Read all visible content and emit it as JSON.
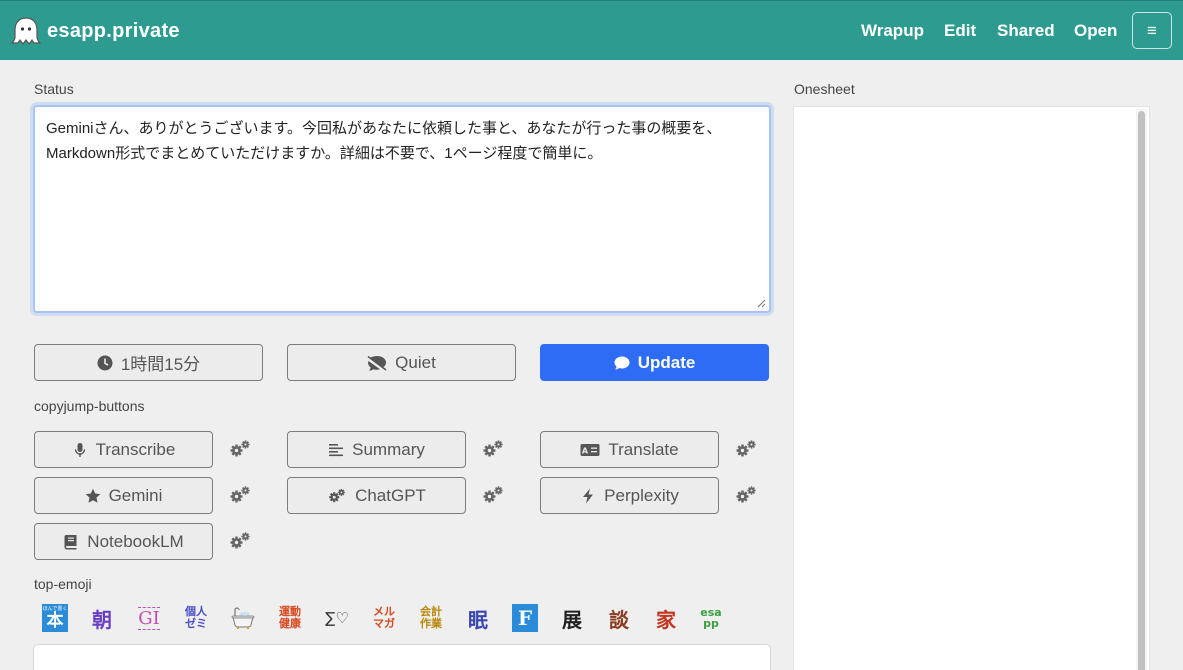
{
  "brand": {
    "name": "esapp.private"
  },
  "nav": {
    "wrapup": "Wrapup",
    "edit": "Edit",
    "shared": "Shared",
    "open": "Open",
    "menu": "≡"
  },
  "status": {
    "label": "Status",
    "text": "Geminiさん、ありがとうございます。今回私があなたに依頼した事と、あなたが行った事の概要を、Markdown形式でまとめていただけますか。詳細は不要で、1ページ程度で簡単に。"
  },
  "actions": {
    "time": "1時間15分",
    "quiet": "Quiet",
    "update": "Update"
  },
  "copyjump": {
    "label": "copyjump-buttons",
    "buttons": {
      "transcribe": "Transcribe",
      "summary": "Summary",
      "translate": "Translate",
      "gemini": "Gemini",
      "chatgpt": "ChatGPT",
      "perplexity": "Perplexity",
      "notebooklm": "NotebookLM"
    }
  },
  "top_emoji": {
    "label": "top-emoji",
    "items": [
      {
        "name": "hon-emoji",
        "text": "本",
        "sub": "ほんで書く",
        "bg": "#2a8bd8",
        "fg": "#ffffff"
      },
      {
        "name": "asa-emoji",
        "text": "朝",
        "fg": "#6b3fc4"
      },
      {
        "name": "gi-emoji",
        "text": "GI",
        "fg": "#c24cb0"
      },
      {
        "name": "kojin-zemi-emoji",
        "text": "個人",
        "text2": "ゼミ",
        "fg": "#4a4fc8"
      },
      {
        "name": "bathtub-emoji",
        "text": "🛁"
      },
      {
        "name": "undou-kenkou-emoji",
        "text": "運動",
        "text2": "健康",
        "fg": "#d9481f"
      },
      {
        "name": "sigma-heart-emoji",
        "text": "∑♡",
        "fg": "#333333"
      },
      {
        "name": "merumaga-emoji",
        "text": "メル",
        "text2": "マガ",
        "fg": "#d9481f"
      },
      {
        "name": "kaikei-sagyou-emoji",
        "text": "会計",
        "text2": "作業",
        "fg": "#b8860b"
      },
      {
        "name": "nemuri-emoji",
        "text": "眠",
        "fg": "#3b46b0"
      },
      {
        "name": "f-emoji",
        "text": "F",
        "bg": "#2a8bd8",
        "fg": "#ffffff"
      },
      {
        "name": "ten-emoji",
        "text": "展",
        "fg": "#222222"
      },
      {
        "name": "dan-emoji",
        "text": "談",
        "fg": "#8a3a1e"
      },
      {
        "name": "ie-emoji",
        "text": "家",
        "fg": "#c4341c"
      },
      {
        "name": "esapp-emoji",
        "text": "esa",
        "text2": "pp",
        "fg": "#3aa040"
      }
    ]
  },
  "onesheet": {
    "label": "Onesheet"
  },
  "colors": {
    "navbar": "#2e9b91",
    "primary": "#2f6cf6"
  }
}
